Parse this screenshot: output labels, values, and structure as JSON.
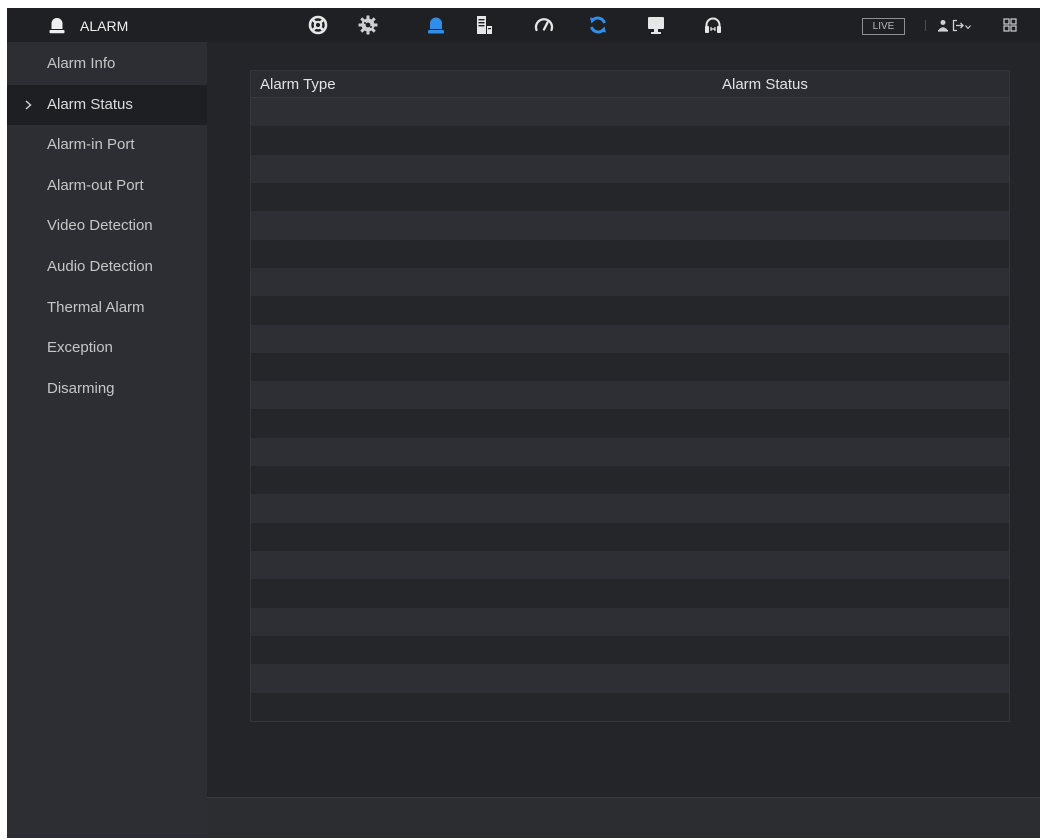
{
  "header": {
    "title": "ALARM",
    "title_icon": "alarm-light-icon",
    "nav_icons": [
      {
        "icon": "lifebuoy-icon",
        "active": false
      },
      {
        "icon": "intelligence-icon",
        "active": false
      },
      {
        "icon": "alarm-light-icon",
        "active": true
      },
      {
        "icon": "storage-icon",
        "active": false
      },
      {
        "icon": "gauge-icon",
        "active": false
      },
      {
        "icon": "refresh-icon",
        "active": false
      },
      {
        "icon": "monitor-icon",
        "active": false
      },
      {
        "icon": "headset-icon",
        "active": false
      }
    ],
    "live_label": "LIVE",
    "right_icons": [
      "user-icon",
      "logout-icon",
      "chevron-down-icon",
      "grid-icon"
    ]
  },
  "sidebar": {
    "items": [
      {
        "label": "Alarm Info",
        "selected": false
      },
      {
        "label": "Alarm Status",
        "selected": true
      },
      {
        "label": "Alarm-in Port",
        "selected": false
      },
      {
        "label": "Alarm-out Port",
        "selected": false
      },
      {
        "label": "Video Detection",
        "selected": false
      },
      {
        "label": "Audio Detection",
        "selected": false
      },
      {
        "label": "Thermal Alarm",
        "selected": false
      },
      {
        "label": "Exception",
        "selected": false
      },
      {
        "label": "Disarming",
        "selected": false
      }
    ]
  },
  "table": {
    "columns": [
      "Alarm Type",
      "Alarm Status"
    ],
    "rows": []
  },
  "colors": {
    "accent": "#2f8fe8",
    "top_bar": "#1e2024",
    "sidebar": "#2c2e33",
    "sidebar_selected": "#1e1f23",
    "content": "#232529",
    "row_light": "#2d2f34",
    "row_dark": "#24262a",
    "text": "#c6c6c6",
    "header_text": "#e2e2e2",
    "bottom_bar": "#2b2d31"
  }
}
